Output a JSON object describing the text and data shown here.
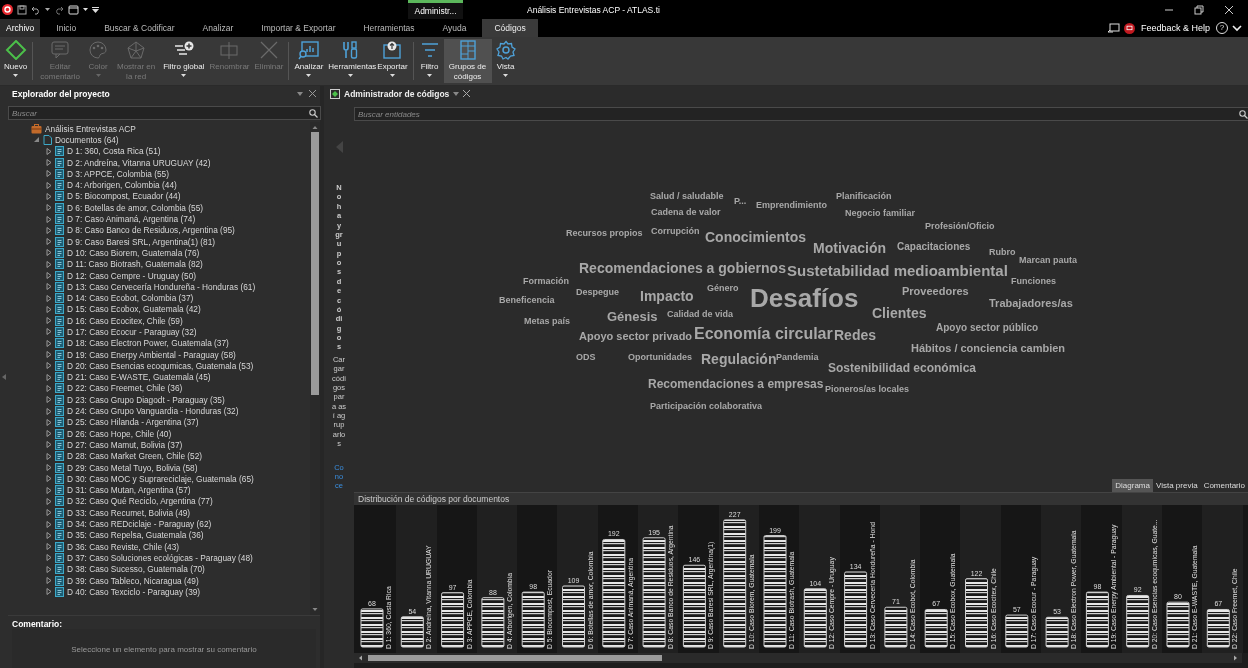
{
  "title_bar": {
    "context_label": "Administr...",
    "title": "Análisis Entrevistas ACP - ATLAS.ti"
  },
  "menu_tabs": [
    {
      "label": "Archivo",
      "kind": "file",
      "selected": false
    },
    {
      "label": "Inicio",
      "kind": "tab",
      "selected": false
    },
    {
      "label": "Buscar & Codificar",
      "kind": "tab",
      "selected": false
    },
    {
      "label": "Analizar",
      "kind": "tab",
      "selected": false
    },
    {
      "label": "Importar & Exportar",
      "kind": "tab",
      "selected": false
    },
    {
      "label": "Herramientas",
      "kind": "tab",
      "selected": false
    },
    {
      "label": "Ayuda",
      "kind": "tab",
      "selected": false
    },
    {
      "label": "Códigos",
      "kind": "tab",
      "selected": true
    }
  ],
  "help_bar": {
    "feedback": "Feedback & Help",
    "help": "?"
  },
  "ribbon": {
    "groups": [
      [
        {
          "label": "Nuevo",
          "kind": "new",
          "disabled": false,
          "dropdown": true,
          "selected": false
        }
      ],
      [
        {
          "label": "Editar comentario",
          "kind": "comment",
          "disabled": true,
          "dropdown": false,
          "selected": false
        },
        {
          "label": "Color",
          "kind": "color",
          "disabled": true,
          "dropdown": true,
          "selected": false
        },
        {
          "label": "Mostrar en la red",
          "kind": "network",
          "disabled": true,
          "dropdown": false,
          "selected": false
        },
        {
          "label": "Filtro global",
          "kind": "global-filter",
          "disabled": false,
          "dropdown": true,
          "selected": false
        },
        {
          "label": "Renombrar",
          "kind": "rename",
          "disabled": true,
          "dropdown": false,
          "selected": false
        },
        {
          "label": "Eliminar",
          "kind": "delete",
          "disabled": true,
          "dropdown": false,
          "selected": false
        }
      ],
      [
        {
          "label": "Analizar",
          "kind": "analyze",
          "disabled": false,
          "dropdown": true,
          "selected": false
        },
        {
          "label": "Herramientas",
          "kind": "tools",
          "disabled": false,
          "dropdown": true,
          "selected": false
        },
        {
          "label": "Exportar",
          "kind": "export",
          "disabled": false,
          "dropdown": true,
          "selected": false
        }
      ],
      [
        {
          "label": "Filtro",
          "kind": "filter",
          "disabled": false,
          "dropdown": true,
          "selected": false
        },
        {
          "label": "Grupos de códigos",
          "kind": "groups",
          "disabled": false,
          "dropdown": false,
          "selected": true
        },
        {
          "label": "Vista",
          "kind": "view",
          "disabled": false,
          "dropdown": true,
          "selected": false
        }
      ]
    ]
  },
  "project_explorer": {
    "title": "Explorador del proyecto",
    "search": {
      "placeholder": "Buscar"
    },
    "tree": [
      {
        "label": "Análisis Entrevistas ACP",
        "kind": "project",
        "children": [
          {
            "label": "Documentos (64)",
            "kind": "group",
            "expanded": true,
            "children": [
              {
                "label": "D 1: 360, Costa Rica (51)",
                "kind": "document",
                "expanded": false
              },
              {
                "label": "D 2: Andreína, Vitanna URUGUAY (42)",
                "kind": "document",
                "expanded": false
              },
              {
                "label": "D 3: APPCE, Colombia (55)",
                "kind": "document",
                "expanded": false
              },
              {
                "label": "D 4: Arborigen, Colombia (44)",
                "kind": "document",
                "expanded": false
              },
              {
                "label": "D 5: Biocompost, Ecuador (44)",
                "kind": "document",
                "expanded": false
              },
              {
                "label": "D 6: Botellas de amor, Colombia (55)",
                "kind": "document",
                "expanded": false
              },
              {
                "label": "D 7: Caso Animaná, Argentina (74)",
                "kind": "document",
                "expanded": false
              },
              {
                "label": "D 8: Caso Banco de Residuos, Argentina (95)",
                "kind": "document",
                "expanded": false
              },
              {
                "label": "D 9: Caso Baresi SRL, Argentina(1) (81)",
                "kind": "document",
                "expanded": false
              },
              {
                "label": "D 10: Caso Biorem, Guatemala (76)",
                "kind": "document",
                "expanded": false
              },
              {
                "label": "D 11: Caso Biotrash, Guatemala (82)",
                "kind": "document",
                "expanded": false
              },
              {
                "label": "D 12: Caso Cempre - Uruguay (50)",
                "kind": "document",
                "expanded": false
              },
              {
                "label": "D 13: Caso Cervecería Hondureña - Honduras (61)",
                "kind": "document",
                "expanded": false
              },
              {
                "label": "D 14: Caso Ecobot, Colombia (37)",
                "kind": "document",
                "expanded": false
              },
              {
                "label": "D 15: Caso Ecobox, Guatemala (42)",
                "kind": "document",
                "expanded": false
              },
              {
                "label": "D 16: Caso Ecocitex, Chile (59)",
                "kind": "document",
                "expanded": false
              },
              {
                "label": "D 17: Caso Ecocur - Paraguay (32)",
                "kind": "document",
                "expanded": false
              },
              {
                "label": "D 18: Caso Electron Power, Guatemala (37)",
                "kind": "document",
                "expanded": false
              },
              {
                "label": "D 19: Caso Enerpy Ambiental - Paraguay (58)",
                "kind": "document",
                "expanded": false
              },
              {
                "label": "D 20: Caso Esencias ecoqumicas, Guatemala (53)",
                "kind": "document",
                "expanded": false
              },
              {
                "label": "D 21: Caso E-WASTE, Guatemala (45)",
                "kind": "document",
                "expanded": false
              },
              {
                "label": "D 22: Caso Freemet, Chile (36)",
                "kind": "document",
                "expanded": false
              },
              {
                "label": "D 23: Caso Grupo Diagodt - Paraguay (35)",
                "kind": "document",
                "expanded": false
              },
              {
                "label": "D 24: Caso Grupo Vanguardia - Honduras (32)",
                "kind": "document",
                "expanded": false
              },
              {
                "label": "D 25: Caso Hilanda - Argentina (37)",
                "kind": "document",
                "expanded": false
              },
              {
                "label": "D 26: Caso Hope, Chile (40)",
                "kind": "document",
                "expanded": false
              },
              {
                "label": "D 27: Caso Mamut, Bolivia (37)",
                "kind": "document",
                "expanded": false
              },
              {
                "label": "D 28: Caso Market Green, Chile (52)",
                "kind": "document",
                "expanded": false
              },
              {
                "label": "D 29: Caso Metal Tuyo, Bolivia (58)",
                "kind": "document",
                "expanded": false
              },
              {
                "label": "D 30: Caso MOC y Suprareciclaje, Guatemala (65)",
                "kind": "document",
                "expanded": false
              },
              {
                "label": "D 31: Caso Mutan, Argentina (57)",
                "kind": "document",
                "expanded": false
              },
              {
                "label": "D 32: Caso Qué Reciclo, Argentina (77)",
                "kind": "document",
                "expanded": false
              },
              {
                "label": "D 33: Caso Recumet, Bolivia (49)",
                "kind": "document",
                "expanded": false
              },
              {
                "label": "D 34: Caso REDciclaje - Paraguay (62)",
                "kind": "document",
                "expanded": false
              },
              {
                "label": "D 35: Caso Repelsa, Guatemala (36)",
                "kind": "document",
                "expanded": false
              },
              {
                "label": "D 36: Caso Reviste, Chile (43)",
                "kind": "document",
                "expanded": false
              },
              {
                "label": "D 37: Caso Soluciones ecológicas - Paraguay (48)",
                "kind": "document",
                "expanded": false
              },
              {
                "label": "D 38: Caso Sucesso, Guatemala (70)",
                "kind": "document",
                "expanded": false
              },
              {
                "label": "D 39: Caso Tableco, Nicaragua (49)",
                "kind": "document",
                "expanded": false
              },
              {
                "label": "D 40: Caso Texciclo - Paraguay (39)",
                "kind": "document",
                "expanded": false
              }
            ]
          }
        ]
      }
    ],
    "comment": {
      "title": "Comentario:",
      "message": "Seleccione un elemento para mostrar su comentario"
    }
  },
  "code_manager": {
    "tab": "Administrador de códigos",
    "search": {
      "placeholder": "Buscar entidades"
    },
    "side_notes": [
      "No hay grupos de códigos",
      "Cargar códigos para así agruparlos"
    ],
    "side_link": "Conoce",
    "word_cloud": [
      "Salud / saludable",
      "P...",
      "Emprendimiento",
      "Planificación",
      "Cadena de valor",
      "Negocio familiar",
      "Profesión/Oficio",
      "Recursos propios",
      "Corrupción",
      "Conocimientos",
      "Motivación",
      "Capacitaciones",
      "Rubro",
      "Marcan pauta",
      "Recomendaciones a gobiernos",
      "Sustetabilidad medioambiental",
      "Formación",
      "Funciones",
      "Despegue",
      "Impacto",
      "Género",
      "Desafíos",
      "Proveedores",
      "Beneficencia",
      "Trabajadores/as",
      "Clientes",
      "Metas país",
      "Génesis",
      "Calidad de vida",
      "Apoyo sector público",
      "Apoyo sector privado",
      "Economía circular",
      "Redes",
      "Hábitos / conciencia cambien",
      "ODS",
      "Oportunidades",
      "Regulación",
      "Pandemia",
      "Sostenibilidad económica",
      "Recomendaciones a empresas",
      "Pioneros/as locales",
      "Participación colaborativa"
    ],
    "view_tabs": [
      {
        "label": "Diagrama",
        "selected": true
      },
      {
        "label": "Vista previa",
        "selected": false
      },
      {
        "label": "Comentario",
        "selected": false
      }
    ],
    "chart_panel": {
      "chart_data": {
        "type": "bar",
        "title": "Distribución de códigos por documentos",
        "categories": [
          "D 1: 360, Costa Rica",
          "D 2: Andreína, Vitanna URUGUAY",
          "D 3: APPCE, Colombia",
          "D 4: Arborigen, Colombia",
          "D 5: Biocompost, Ecuador",
          "D 6: Botellas de amor, Colombia",
          "D 7: Caso Animaná, Argentina",
          "D 8: Caso Banco de Residuos, Argentina",
          "D 9: Caso Baresi SRL, Argentina(1)",
          "D 10: Caso Biorem, Guatemala",
          "D 11: Caso Biotrash, Guatemala",
          "D 12: Caso Cempre - Uruguay",
          "D 13: Caso Cervecería Hondureña - Hond",
          "D 14: Caso Ecobot, Colombia",
          "D 15: Caso Ecobox, Guatemala",
          "D 16: Caso Ecocitex, Chile",
          "D 17: Caso Ecocur - Paraguay",
          "D 18: Caso Electron Power, Guatemala",
          "D 19: Caso Enerpy Ambiental - Paraguay",
          "D 20: Caso Esencias ecoqumicas, Guate...",
          "D 21: Caso E-WASTE, Guatemala",
          "D 22: Caso Freemet, Chile"
        ],
        "values": [
          68,
          54,
          97,
          88,
          98,
          109,
          192,
          195,
          146,
          227,
          199,
          104,
          134,
          71,
          67,
          122,
          57,
          53,
          98,
          92,
          80,
          67
        ],
        "data_labels": true
      }
    }
  }
}
